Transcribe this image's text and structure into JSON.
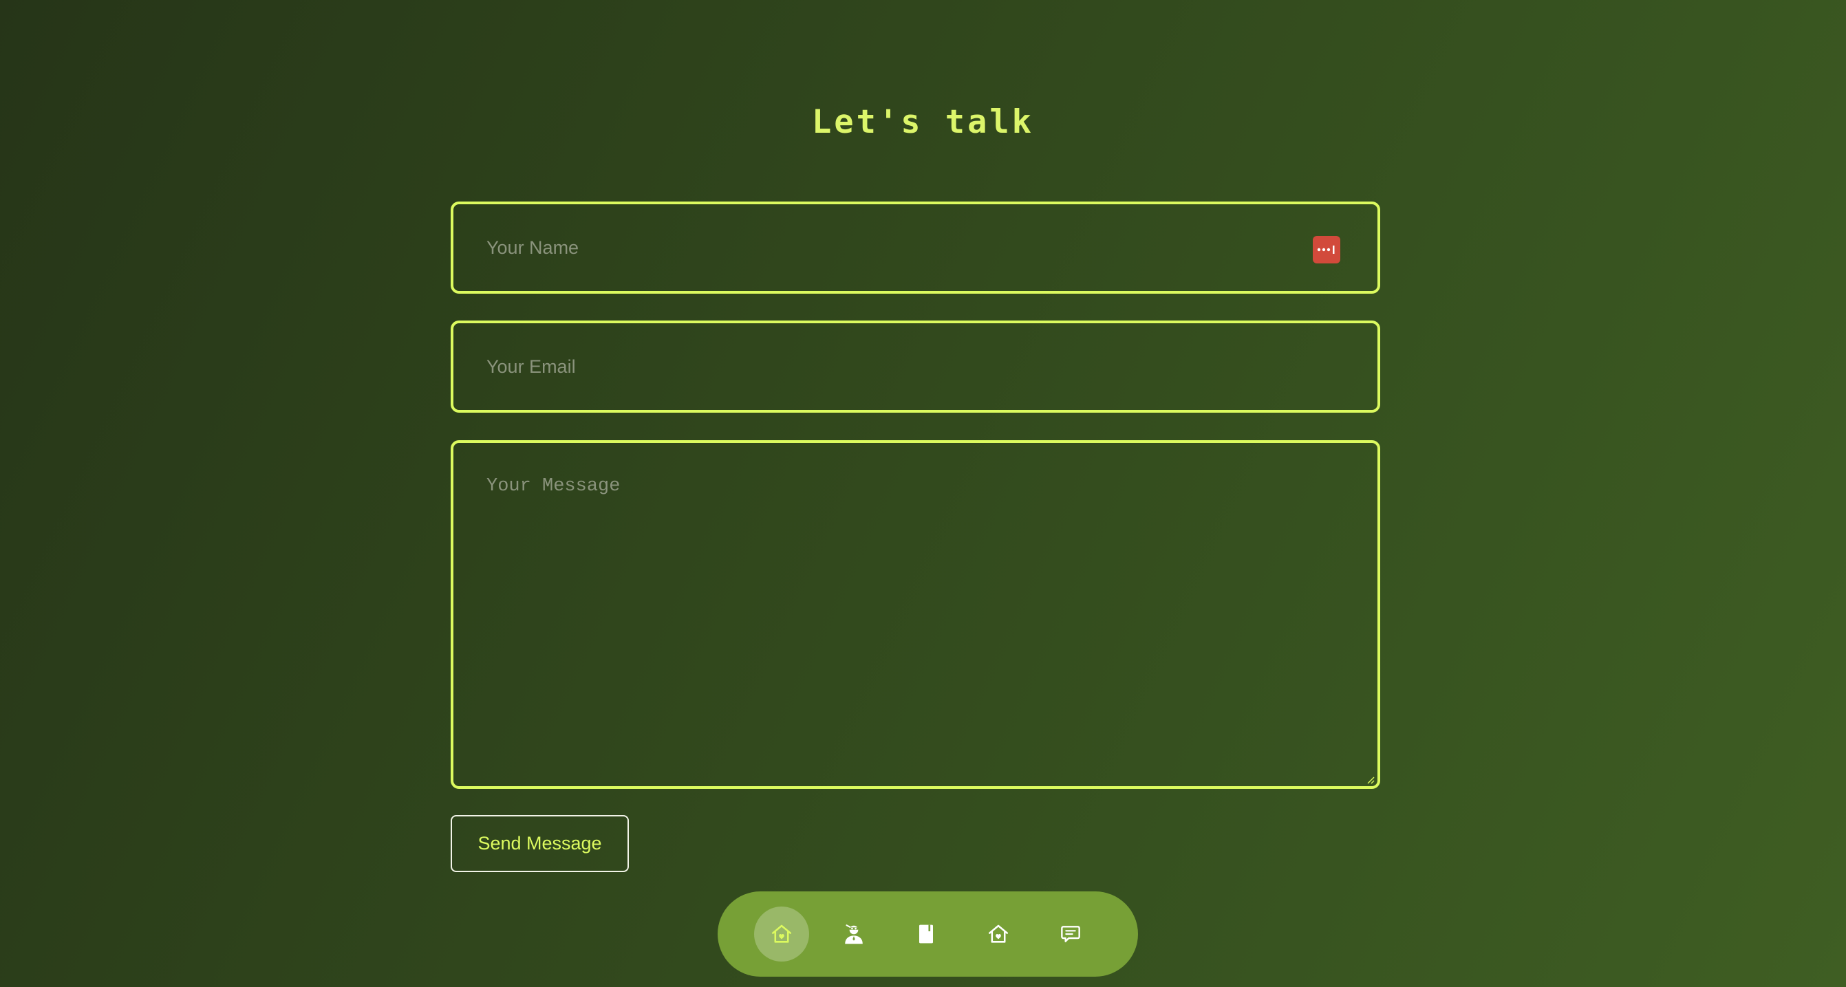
{
  "page": {
    "title": "Let's talk"
  },
  "form": {
    "name_placeholder": "Your Name",
    "email_placeholder": "Your Email",
    "message_placeholder": "Your Message",
    "submit_label": "Send Message"
  },
  "nav": {
    "items": [
      {
        "icon": "home-heart-icon",
        "active": true
      },
      {
        "icon": "user-icon",
        "active": false
      },
      {
        "icon": "book-icon",
        "active": false
      },
      {
        "icon": "home-heart-icon",
        "active": false
      },
      {
        "icon": "chat-icon",
        "active": false
      }
    ]
  },
  "colors": {
    "accent": "#dcfa5f",
    "nav_background": "#77a036",
    "password_manager_icon": "#d24a3b"
  }
}
